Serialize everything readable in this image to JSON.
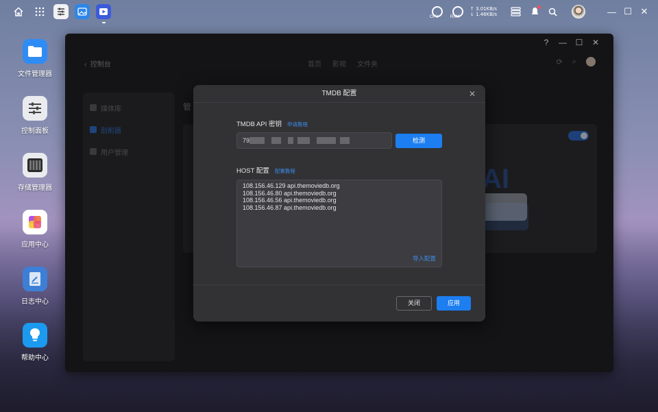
{
  "taskbar": {
    "net_up": "↑ 3.01KB/s",
    "net_down": "↓ 1.46KB/s",
    "cpu_label": "CPU",
    "ram_label": "RAM"
  },
  "desktop": {
    "items": [
      {
        "label": "文件管理器",
        "icon": "folder-icon",
        "color": "#2f8cf4"
      },
      {
        "label": "控制面板",
        "icon": "sliders-icon",
        "color": "#e9ebef"
      },
      {
        "label": "存储管理器",
        "icon": "storage-icon",
        "color": "#e9ebef"
      },
      {
        "label": "应用中心",
        "icon": "app-center-icon",
        "color": "#ffffff"
      },
      {
        "label": "日志中心",
        "icon": "log-icon",
        "color": "#3d7fd6"
      },
      {
        "label": "帮助中心",
        "icon": "lightbulb-icon",
        "color": "#1b9af0"
      }
    ]
  },
  "window": {
    "back_label": "控制台",
    "nav_tabs": [
      "首页",
      "影视",
      "文件夹"
    ],
    "sidebar": [
      "媒体库",
      "刮削器",
      "用户管理"
    ],
    "content_title": "管"
  },
  "dialog": {
    "title": "TMDB 配置",
    "api_key_label": "TMDB API 密钥",
    "api_key_link": "申请教程",
    "api_key_value": "79",
    "check_button": "检测",
    "host_label": "HOST 配置",
    "host_link": "配置教程",
    "hosts": [
      "108.156.46.129 api.themoviedb.org",
      "108.156.46.80 api.themoviedb.org",
      "108.156.46.56 api.themoviedb.org",
      "108.156.46.87 api.themoviedb.org"
    ],
    "import_link": "导入配置",
    "close_button": "关闭",
    "apply_button": "应用"
  }
}
